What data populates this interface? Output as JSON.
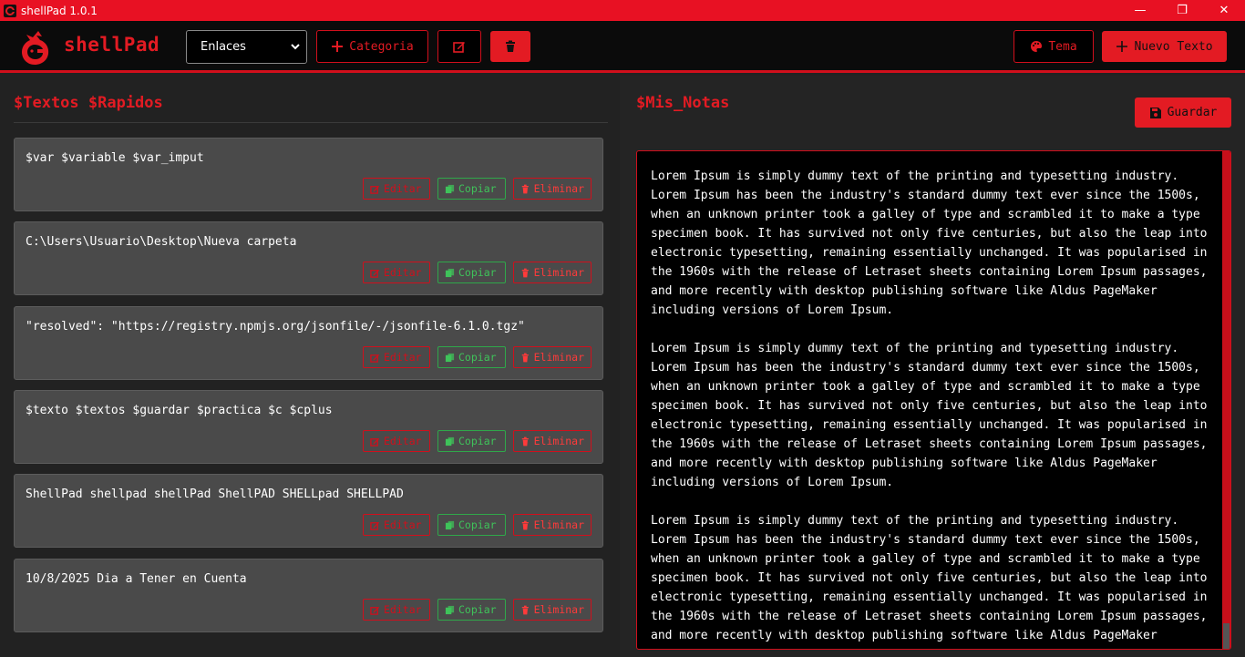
{
  "window": {
    "title": "shellPad 1.0.1",
    "controls": {
      "minimize": "—",
      "maximize": "❐",
      "close": "✕"
    }
  },
  "header": {
    "brand": "shellPad",
    "category_select": {
      "value": "Enlaces"
    },
    "add_category_label": "Categoria",
    "theme_label": "Tema",
    "new_text_label": "Nuevo Texto"
  },
  "left": {
    "title": "$Textos $Rapidos",
    "actions": {
      "edit": "Editar",
      "copy": "Copiar",
      "delete": "Eliminar"
    },
    "items": [
      {
        "text": "$var $variable $var_imput"
      },
      {
        "text": "C:\\Users\\Usuario\\Desktop\\Nueva carpeta"
      },
      {
        "text": "\"resolved\": \"https://registry.npmjs.org/jsonfile/-/jsonfile-6.1.0.tgz\""
      },
      {
        "text": "$texto $textos $guardar $practica $c $cplus"
      },
      {
        "text": "ShellPad shellpad shellPad ShellPAD SHELLpad SHELLPAD"
      },
      {
        "text": "10/8/2025 Dia a Tener en Cuenta"
      }
    ]
  },
  "right": {
    "title": "$Mis_Notas",
    "save_label": "Guardar",
    "notes": "Lorem Ipsum is simply dummy text of the printing and typesetting industry.\nLorem Ipsum has been the industry's standard dummy text ever since the 1500s,\nwhen an unknown printer took a galley of type and scrambled it to make a type\nspecimen book. It has survived not only five centuries, but also the leap into\nelectronic typesetting, remaining essentially unchanged. It was popularised in\nthe 1960s with the release of Letraset sheets containing Lorem Ipsum passages,\nand more recently with desktop publishing software like Aldus PageMaker\nincluding versions of Lorem Ipsum.\n\nLorem Ipsum is simply dummy text of the printing and typesetting industry.\nLorem Ipsum has been the industry's standard dummy text ever since the 1500s,\nwhen an unknown printer took a galley of type and scrambled it to make a type\nspecimen book. It has survived not only five centuries, but also the leap into\nelectronic typesetting, remaining essentially unchanged. It was popularised in\nthe 1960s with the release of Letraset sheets containing Lorem Ipsum passages,\nand more recently with desktop publishing software like Aldus PageMaker\nincluding versions of Lorem Ipsum.\n\nLorem Ipsum is simply dummy text of the printing and typesetting industry.\nLorem Ipsum has been the industry's standard dummy text ever since the 1500s,\nwhen an unknown printer took a galley of type and scrambled it to make a type\nspecimen book. It has survived not only five centuries, but also the leap into\nelectronic typesetting, remaining essentially unchanged. It was popularised in\nthe 1960s with the release of Letraset sheets containing Lorem Ipsum passages,\nand more recently with desktop publishing software like Aldus PageMaker\nincluding versions of Lorem Ipsum."
  },
  "colors": {
    "accent": "#e31b23",
    "titlebar": "#e81123",
    "copy_green": "#3fc35a"
  },
  "icons": {
    "app": "dragon-icon",
    "add": "plus-icon",
    "edit": "edit-icon",
    "delete": "trash-icon",
    "theme": "palette-icon",
    "save": "save-icon",
    "copy": "copy-icon"
  }
}
